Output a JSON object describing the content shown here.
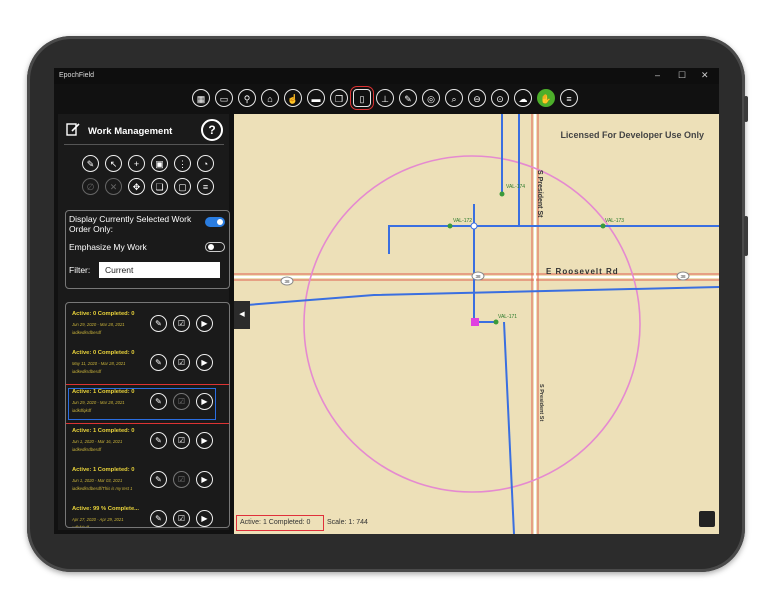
{
  "window": {
    "title": "EpochField",
    "controls": [
      "–",
      "☐",
      "✕"
    ]
  },
  "toolbar": {
    "buttons": [
      {
        "icon": "layers-icon",
        "glyph": "▦"
      },
      {
        "icon": "screen-icon",
        "glyph": "▭"
      },
      {
        "icon": "locate-icon",
        "glyph": "⚲"
      },
      {
        "icon": "home-search-icon",
        "glyph": "⌂"
      },
      {
        "icon": "hand-pointer-icon",
        "glyph": "☝"
      },
      {
        "icon": "vehicle-icon",
        "glyph": "▬"
      },
      {
        "icon": "book-icon",
        "glyph": "❐"
      },
      {
        "icon": "clipboard-icon",
        "glyph": "▯"
      },
      {
        "icon": "measure-icon",
        "glyph": "⊥"
      },
      {
        "icon": "edit-icon",
        "glyph": "✎"
      },
      {
        "icon": "compass-icon",
        "glyph": "◎"
      },
      {
        "icon": "search-icon",
        "glyph": "⌕"
      },
      {
        "icon": "zoom-out-icon",
        "glyph": "⊖"
      },
      {
        "icon": "zoom-extent-icon",
        "glyph": "⊙"
      },
      {
        "icon": "cloud-upload-icon",
        "glyph": "☁"
      },
      {
        "icon": "hand-icon",
        "glyph": "✋"
      },
      {
        "icon": "menu-icon",
        "glyph": "≡"
      }
    ],
    "selected_index": 7
  },
  "panel": {
    "title": "Work Management",
    "help_glyph": "?",
    "action_icons_row1": [
      {
        "icon": "pencil-icon",
        "glyph": "✎"
      },
      {
        "icon": "cursor-icon",
        "glyph": "↖"
      },
      {
        "icon": "add-icon",
        "glyph": "+"
      },
      {
        "icon": "grid-icon",
        "glyph": "▣"
      },
      {
        "icon": "more-vertical-icon",
        "glyph": "⋮"
      },
      {
        "icon": "globe-icon",
        "glyph": "◔"
      }
    ],
    "action_icons_row2": [
      {
        "icon": "disabled-icon",
        "glyph": "∅",
        "dim": true
      },
      {
        "icon": "cancel-icon",
        "glyph": "✕",
        "dim": true
      },
      {
        "icon": "move-icon",
        "glyph": "✥",
        "dim": false
      },
      {
        "icon": "copy-icon",
        "glyph": "❏",
        "dim": false
      },
      {
        "icon": "layout-icon",
        "glyph": "▢",
        "dim": false
      },
      {
        "icon": "list-icon",
        "glyph": "≡",
        "dim": false
      }
    ],
    "display_selected_label": "Display Currently Selected Work Order Only:",
    "display_selected_on": true,
    "emphasize_label": "Emphasize My Work",
    "emphasize_on": false,
    "filter_label": "Filter:",
    "filter_value": "Current"
  },
  "work_orders": [
    {
      "status": "Active: 0 Completed: 0",
      "dates": "Jun 29, 2020 - Mar 28, 2021",
      "owner": "iadkedksdbesdf",
      "selected": false,
      "icons": [
        "✎",
        "☑",
        "▶"
      ],
      "dim_mid": false
    },
    {
      "status": "Active: 0 Completed: 0",
      "dates": "May 11, 2020 - Mar 28, 2021",
      "owner": "iadkedksdbesdf",
      "selected": false,
      "icons": [
        "✎",
        "☑",
        "▶"
      ],
      "dim_mid": false
    },
    {
      "status": "Active: 1 Completed: 0",
      "dates": "Jun 29, 2020 - Mar 28, 2021",
      "owner": "iadkdfqkdf",
      "selected": true,
      "icons": [
        "✎",
        "☑",
        "▶"
      ],
      "dim_mid": true
    },
    {
      "status": "Active: 1 Completed: 0",
      "dates": "Jun 1, 2020 - Mar 16, 2021",
      "owner": "iadkedksdbesdf",
      "selected": false,
      "icons": [
        "✎",
        "☑",
        "▶"
      ],
      "dim_mid": false
    },
    {
      "status": "Active: 1 Completed: 0",
      "dates": "Jun 1, 2020 - Mar 03, 2021",
      "owner": "iadkedksdbesdf/This is my test 1",
      "selected": false,
      "icons": [
        "✎",
        "☑",
        "▶"
      ],
      "dim_mid": true
    },
    {
      "status": "Active: 99 % Complete...",
      "dates": "Apr 27, 2020 - Apr 29, 2021",
      "owner": "xdfsfdsdf",
      "selected": false,
      "icons": [
        "✎",
        "☑",
        "▶"
      ],
      "dim_mid": false
    }
  ],
  "map": {
    "watermark": "Licensed For Developer Use Only",
    "road_name_h": "E Roosevelt Rd",
    "road_name_v": "S President St",
    "route_shield": "38",
    "valve_labels": [
      "VAL-174",
      "VAL-172",
      "VAL-173",
      "VAL-171"
    ],
    "colors": {
      "background": "#ede0b8",
      "water_main": "#3a6fe0",
      "circle": "#e58ad0",
      "road": "#e06050",
      "selected_node": "#e040e0"
    }
  },
  "status_bar": {
    "work_summary": "Active: 1 Completed: 0",
    "scale_label": "Scale:",
    "scale_value": "1: 744"
  }
}
